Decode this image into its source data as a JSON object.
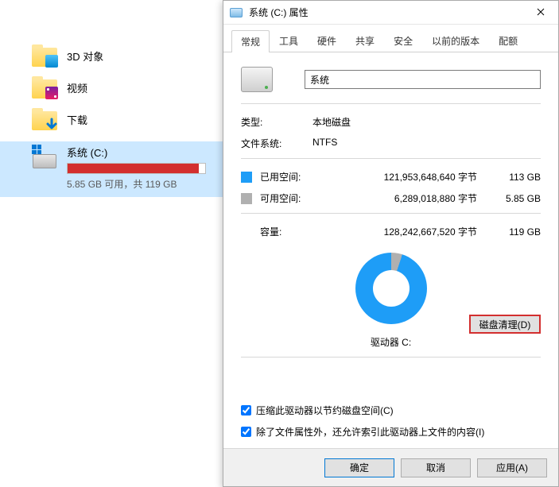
{
  "sidebar": {
    "folders": [
      {
        "label": "3D 对象",
        "overlay": "3d"
      },
      {
        "label": "视频",
        "overlay": "video"
      },
      {
        "label": "下载",
        "overlay": "download"
      }
    ],
    "drive": {
      "title": "系统 (C:)",
      "subtitle": "5.85 GB 可用，共 119 GB"
    }
  },
  "dialog": {
    "title": "系统 (C:) 属性",
    "tabs": [
      "常规",
      "工具",
      "硬件",
      "共享",
      "安全",
      "以前的版本",
      "配额"
    ],
    "active_tab": 0,
    "name_value": "系统",
    "type_label": "类型:",
    "type_value": "本地磁盘",
    "fs_label": "文件系统:",
    "fs_value": "NTFS",
    "used_label": "已用空间:",
    "used_bytes": "121,953,648,640 字节",
    "used_gb": "113 GB",
    "free_label": "可用空间:",
    "free_bytes": "6,289,018,880 字节",
    "free_gb": "5.85 GB",
    "cap_label": "容量:",
    "cap_bytes": "128,242,667,520 字节",
    "cap_gb": "119 GB",
    "pie_label": "驱动器 C:",
    "cleanup_label": "磁盘清理(D)",
    "check1": "压缩此驱动器以节约磁盘空间(C)",
    "check2": "除了文件属性外，还允许索引此驱动器上文件的内容(I)",
    "ok": "确定",
    "cancel": "取消",
    "apply": "应用(A)"
  }
}
